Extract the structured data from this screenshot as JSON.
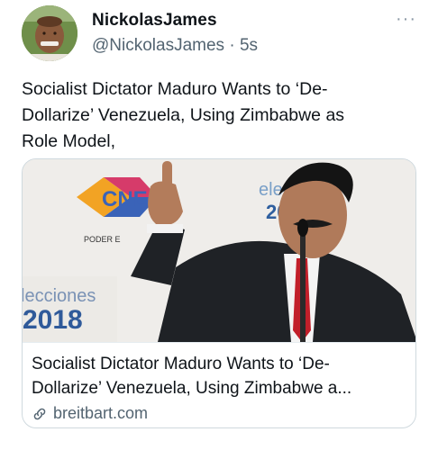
{
  "author": {
    "display_name": "NickolasJames",
    "handle": "@NickolasJames",
    "separator": "·",
    "time": "5s"
  },
  "more_label": "···",
  "tweet": {
    "text": "Socialist Dictator Maduro Wants to ‘De-\nDollarize’ Venezuela, Using Zimbabwe as\nRole Model,"
  },
  "card": {
    "title": "Socialist Dictator Maduro Wants to ‘De-\nDollarize’ Venezuela, Using Zimbabwe a...",
    "source": "breitbart.com",
    "image_text": {
      "logo_left": "CNE",
      "logo_right": "elecc",
      "logo_right_2": "20",
      "poder": "PODER E",
      "elecciones": "lecciones",
      "year": "2018"
    }
  },
  "icons": {
    "avatar": "avatar-photo",
    "more": "more-dots-icon",
    "link": "link-icon"
  },
  "colors": {
    "secondary_text": "#536471",
    "border": "#cfd9de"
  }
}
